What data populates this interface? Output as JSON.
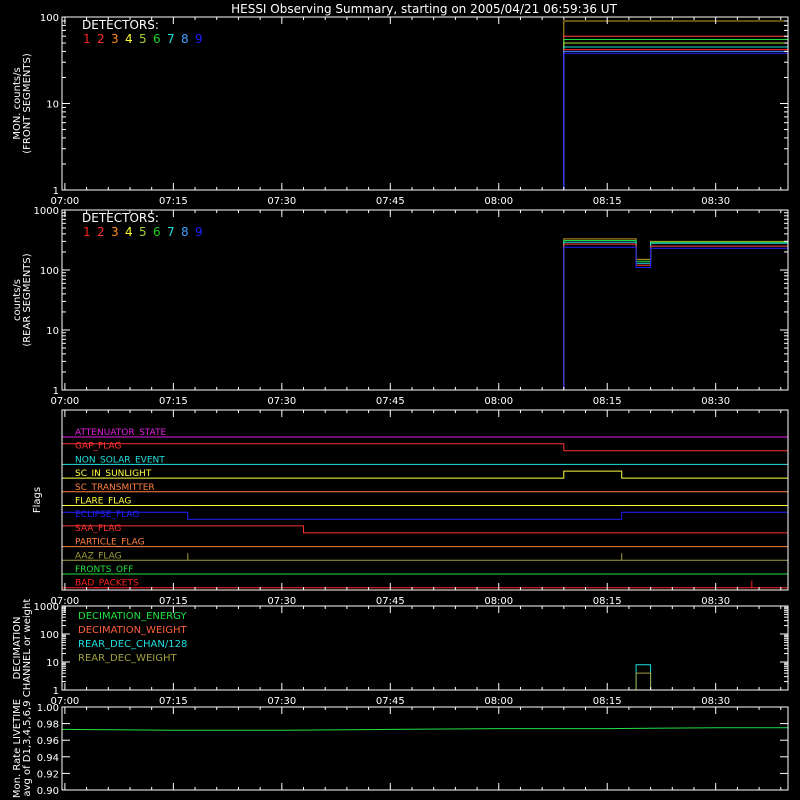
{
  "title": "HESSI Observing Summary, starting on 2005/04/21 06:59:36 UT",
  "time_ticks": [
    "07:00",
    "07:15",
    "07:30",
    "07:45",
    "08:00",
    "08:15",
    "08:30"
  ],
  "detector_colors": [
    "#ff2020",
    "#ff3030",
    "#ff8c20",
    "#ffff30",
    "#a0d040",
    "#20d020",
    "#20e0e0",
    "#40a0ff",
    "#2020ff"
  ],
  "chart_data": [
    {
      "type": "line",
      "id": "front",
      "ylabel_lines": [
        "MON. counts/s",
        "(FRONT SEGMENTS)"
      ],
      "y_scale": "log",
      "ylim": [
        1,
        100
      ],
      "y_ticks": [
        "1",
        "10",
        "100"
      ],
      "legend_title": "DETECTORS:",
      "legend_entries": [
        "1",
        "2",
        "3",
        "4",
        "5",
        "6",
        "7",
        "8",
        "9"
      ],
      "series": [
        {
          "color": "#c8a020",
          "x": [
            "06:59:36",
            "08:09",
            "08:09",
            "08:40"
          ],
          "y": [
            1,
            1,
            90,
            90
          ]
        },
        {
          "color": "#ff4040",
          "x": [
            "06:59:36",
            "08:09",
            "08:09",
            "08:40"
          ],
          "y": [
            1,
            1,
            60,
            60
          ]
        },
        {
          "color": "#20e040",
          "x": [
            "06:59:36",
            "08:09",
            "08:09",
            "08:40"
          ],
          "y": [
            1,
            1,
            55,
            55
          ]
        },
        {
          "color": "#a0e040",
          "x": [
            "06:59:36",
            "08:09",
            "08:09",
            "08:40"
          ],
          "y": [
            1,
            1,
            50,
            50
          ]
        },
        {
          "color": "#20e0e0",
          "x": [
            "06:59:36",
            "08:09",
            "08:09",
            "08:40"
          ],
          "y": [
            1,
            1,
            45,
            45
          ]
        },
        {
          "color": "#ff2020",
          "x": [
            "06:59:36",
            "08:09",
            "08:09",
            "08:40"
          ],
          "y": [
            1,
            1,
            42,
            42
          ]
        },
        {
          "color": "#4080ff",
          "x": [
            "06:59:36",
            "08:09",
            "08:09",
            "08:40"
          ],
          "y": [
            1,
            1,
            40,
            40
          ]
        },
        {
          "color": "#2020ff",
          "x": [
            "06:59:36",
            "08:09",
            "08:09",
            "08:40"
          ],
          "y": [
            1,
            1,
            38,
            38
          ]
        }
      ]
    },
    {
      "type": "line",
      "id": "rear",
      "ylabel_lines": [
        "counts/s",
        "(REAR SEGMENTS)"
      ],
      "y_scale": "log",
      "ylim": [
        1,
        1000
      ],
      "y_ticks": [
        "1",
        "10",
        "100",
        "1000"
      ],
      "legend_title": "DETECTORS:",
      "legend_entries": [
        "1",
        "2",
        "3",
        "4",
        "5",
        "6",
        "7",
        "8",
        "9"
      ],
      "series": [
        {
          "color": "#c8a020",
          "x": [
            "06:59:36",
            "08:09",
            "08:09",
            "08:19",
            "08:19",
            "08:21",
            "08:21",
            "08:40"
          ],
          "y": [
            1,
            1,
            330,
            330,
            150,
            150,
            300,
            300
          ]
        },
        {
          "color": "#20e040",
          "x": [
            "06:59:36",
            "08:09",
            "08:09",
            "08:19",
            "08:19",
            "08:21",
            "08:21",
            "08:40"
          ],
          "y": [
            1,
            1,
            310,
            310,
            140,
            140,
            290,
            290
          ]
        },
        {
          "color": "#20e0e0",
          "x": [
            "06:59:36",
            "08:09",
            "08:09",
            "08:19",
            "08:19",
            "08:21",
            "08:21",
            "08:40"
          ],
          "y": [
            1,
            1,
            290,
            290,
            130,
            130,
            280,
            280
          ]
        },
        {
          "color": "#ff4040",
          "x": [
            "06:59:36",
            "08:09",
            "08:09",
            "08:19",
            "08:19",
            "08:21",
            "08:21",
            "08:40"
          ],
          "y": [
            1,
            1,
            270,
            270,
            120,
            120,
            250,
            250
          ]
        },
        {
          "color": "#2020ff",
          "x": [
            "06:59:36",
            "08:09",
            "08:09",
            "08:19",
            "08:19",
            "08:21",
            "08:21",
            "08:40"
          ],
          "y": [
            1,
            1,
            240,
            240,
            110,
            110,
            230,
            230
          ]
        }
      ]
    },
    {
      "type": "line",
      "id": "flags",
      "ylabel_lines": [
        "Flags"
      ],
      "flags": [
        {
          "label": "ATTENUATOR_STATE",
          "color": "#e020e0",
          "x": [
            "06:59:36",
            "08:40"
          ],
          "y": [
            0,
            0
          ]
        },
        {
          "label": "GAP_FLAG",
          "color": "#ff3030",
          "x": [
            "06:59:36",
            "08:09",
            "08:09",
            "08:40"
          ],
          "y": [
            1,
            1,
            0,
            0
          ]
        },
        {
          "label": "NON_SOLAR_EVENT",
          "color": "#20e0e0",
          "x": [
            "06:59:36",
            "08:40"
          ],
          "y": [
            0,
            0
          ]
        },
        {
          "label": "SC_IN_SUNLIGHT",
          "color": "#ffff40",
          "x": [
            "06:59:36",
            "08:09",
            "08:09",
            "08:17",
            "08:17",
            "08:40"
          ],
          "y": [
            0,
            0,
            1,
            1,
            0,
            0
          ]
        },
        {
          "label": "SC_TRANSMITTER",
          "color": "#ff8040",
          "x": [
            "06:59:36",
            "08:40"
          ],
          "y": [
            0,
            0
          ]
        },
        {
          "label": "FLARE_FLAG",
          "color": "#ffff40",
          "x": [
            "06:59:36",
            "08:40"
          ],
          "y": [
            0,
            0
          ]
        },
        {
          "label": "ECLIPSE_FLAG",
          "color": "#2020ff",
          "x": [
            "06:59:36",
            "07:17",
            "07:17",
            "08:17",
            "08:17",
            "08:40"
          ],
          "y": [
            1,
            1,
            0,
            0,
            1,
            1
          ]
        },
        {
          "label": "SAA_FLAG",
          "color": "#ff3030",
          "x": [
            "06:59:36",
            "07:33",
            "07:33",
            "08:40"
          ],
          "y": [
            1,
            1,
            0,
            0
          ]
        },
        {
          "label": "PARTICLE_FLAG",
          "color": "#ff8040",
          "x": [
            "06:59:36",
            "08:40"
          ],
          "y": [
            0,
            0
          ]
        },
        {
          "label": "AAZ_FLAG",
          "color": "#a0a040",
          "x": [
            "06:59:36",
            "07:17",
            "07:17",
            "07:17",
            "07:17",
            "08:17",
            "08:17",
            "08:17",
            "08:17",
            "08:40"
          ],
          "y": [
            0,
            0,
            1,
            1,
            0,
            0,
            1,
            1,
            0,
            0
          ]
        },
        {
          "label": "FRONTS_OFF",
          "color": "#20e040",
          "x": [
            "06:59:36",
            "08:40"
          ],
          "y": [
            0,
            0
          ]
        },
        {
          "label": "BAD_PACKETS",
          "color": "#ff2020",
          "x": [
            "06:59:36",
            "08:35",
            "08:35",
            "08:35",
            "08:35",
            "08:40"
          ],
          "y": [
            0,
            0,
            1,
            1,
            0,
            0
          ]
        }
      ]
    },
    {
      "type": "line",
      "id": "decimation",
      "ylabel_lines": [
        "DECIMATION",
        "CHANNEL or weight"
      ],
      "y_scale": "log",
      "ylim": [
        1,
        1000
      ],
      "y_ticks": [
        "1",
        "10",
        "100",
        "1000"
      ],
      "legend": [
        {
          "label": "DECIMATION_ENERGY",
          "color": "#20e040"
        },
        {
          "label": "DECIMATION_WEIGHT",
          "color": "#ff6040"
        },
        {
          "label": "REAR_DEC_CHAN/128",
          "color": "#20e0e0"
        },
        {
          "label": "REAR_DEC_WEIGHT",
          "color": "#a0a040"
        }
      ],
      "series": [
        {
          "label": "REAR_DEC_CHAN/128",
          "color": "#20e0e0",
          "x": [
            "06:59:36",
            "08:19",
            "08:19",
            "08:21",
            "08:21",
            "08:40"
          ],
          "y": [
            1,
            1,
            8,
            8,
            1,
            1
          ]
        },
        {
          "label": "REAR_DEC_WEIGHT",
          "color": "#a0a040",
          "x": [
            "06:59:36",
            "08:19",
            "08:19",
            "08:21",
            "08:21",
            "08:40"
          ],
          "y": [
            1,
            1,
            4,
            4,
            1,
            1
          ]
        }
      ]
    },
    {
      "type": "line",
      "id": "livetime",
      "ylabel_lines": [
        "Mon. Rate LIVETIME",
        "avg of D1,3,4,5,6,9"
      ],
      "ylim": [
        0.9,
        1.0
      ],
      "y_ticks": [
        "0.90",
        "0.92",
        "0.94",
        "0.96",
        "0.98",
        "1.00"
      ],
      "series": [
        {
          "color": "#20e040",
          "x": [
            "06:59:36",
            "07:15",
            "07:30",
            "07:45",
            "08:00",
            "08:15",
            "08:30",
            "08:40"
          ],
          "y": [
            0.973,
            0.972,
            0.972,
            0.973,
            0.974,
            0.974,
            0.975,
            0.975
          ]
        }
      ]
    }
  ]
}
